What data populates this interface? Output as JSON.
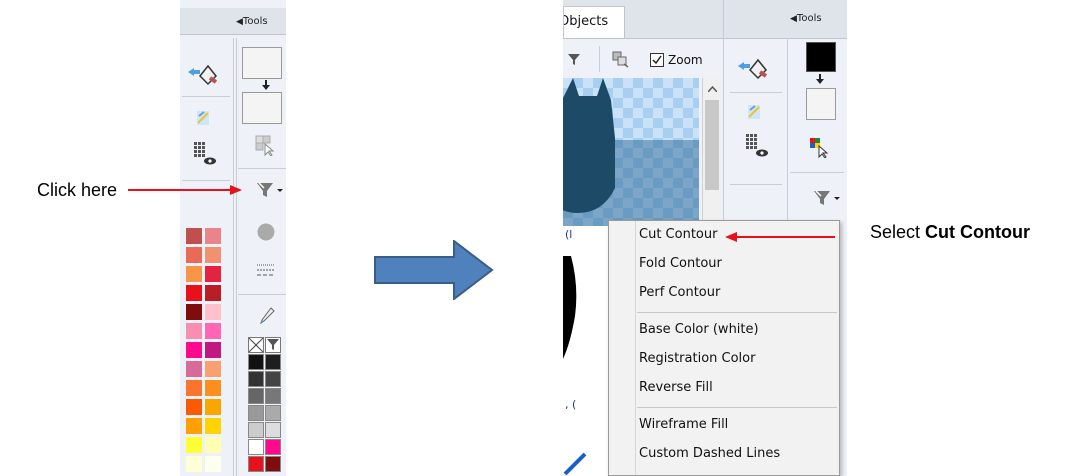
{
  "left_panel": {
    "tools_tab": "Tools",
    "tools_arrow": "◀",
    "palette_colors": [
      [
        "#c0504d",
        "#e9858a"
      ],
      [
        "#e96b57",
        "#f0916f"
      ],
      [
        "#f79646",
        "#e3233f"
      ],
      [
        "#e8101a",
        "#b71e26"
      ],
      [
        "#7f0d0d",
        "#ffc0cb"
      ],
      [
        "#f98fb0",
        "#ff66b3"
      ],
      [
        "#ff0a8c",
        "#c01880"
      ],
      [
        "#d86a9a",
        "#f8a070"
      ],
      [
        "#f9742e",
        "#fa8e1e"
      ],
      [
        "#fb5a04",
        "#fba500"
      ],
      [
        "#fda000",
        "#ffd200"
      ],
      [
        "#ffff33",
        "#ffffb3"
      ],
      [
        "#ffffd6",
        "#fffff0"
      ]
    ],
    "gray_swatches": [
      [
        "#111111",
        "#1e1e1e"
      ],
      [
        "#333333",
        "#444444"
      ],
      [
        "#666666",
        "#777777"
      ],
      [
        "#999999",
        "#aaaaaa"
      ],
      [
        "#cccccc",
        "#dddddd"
      ],
      [
        "#ffffff",
        "#ff0a8c"
      ],
      [
        "#e8101a",
        "#7f0d0d"
      ]
    ]
  },
  "right_panel": {
    "tab_objects": "Objects",
    "tools_tab": "Tools",
    "tools_arrow": "◀",
    "zoom_label": "Zoom",
    "zoom_checked": true
  },
  "annotations": {
    "click_here": "Click here",
    "select_prefix": "Select ",
    "select_bold": "Cut Contour"
  },
  "dropdown_menu": {
    "groups": [
      [
        "Cut Contour",
        "Fold Contour",
        "Perf  Contour"
      ],
      [
        "Base Color (white)",
        "Registration Color",
        "Reverse Fill"
      ],
      [
        "Wireframe Fill",
        "Custom Dashed Lines"
      ]
    ]
  },
  "colors": {
    "arrow_blue": "#4f81bd",
    "arrow_border": "#385d8a",
    "callout_red": "#e8101a"
  }
}
